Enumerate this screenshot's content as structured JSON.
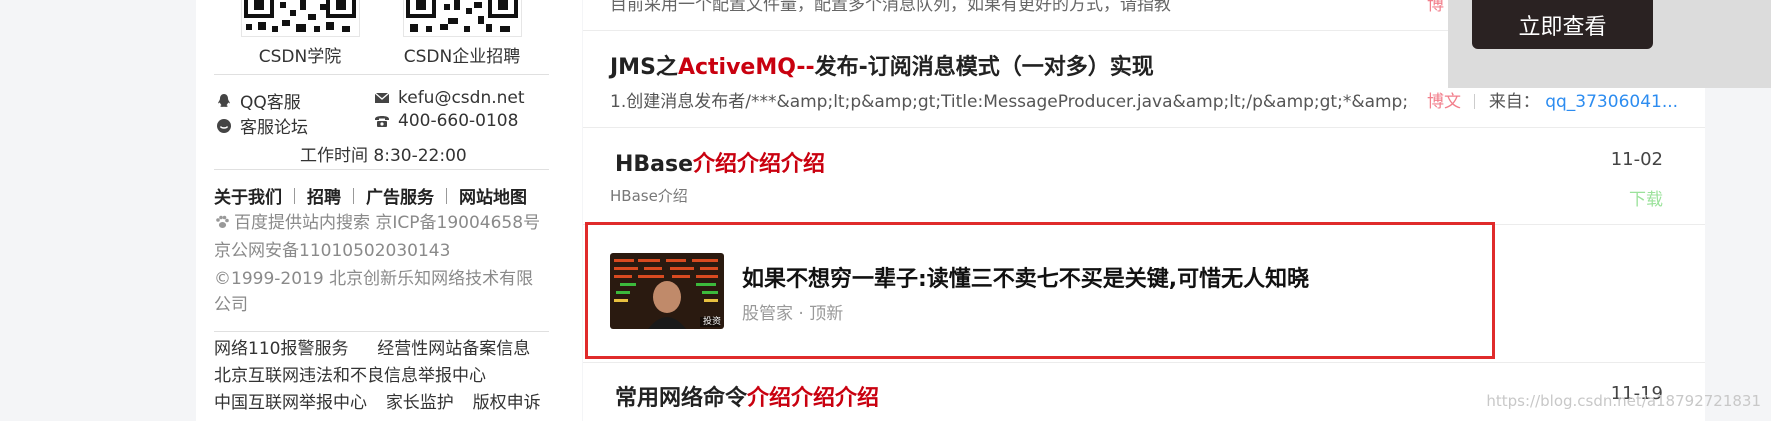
{
  "sidebar": {
    "qr_items": [
      {
        "label": "CSDN学院"
      },
      {
        "label": "CSDN企业招聘"
      }
    ],
    "contacts": {
      "qq": "QQ客服",
      "email": "kefu@csdn.net",
      "forum": "客服论坛",
      "phone": "400-660-0108"
    },
    "work_time": "工作时间 8:30-22:00",
    "footer_links": [
      "关于我们",
      "招聘",
      "广告服务",
      "网站地图"
    ],
    "gray_lines": [
      "百度提供站内搜索 京ICP备19004658号",
      "京公网安备11010502030143",
      "©1999-2019 北京创新乐知网络技术有限",
      "公司"
    ],
    "bottom_links": {
      "line1_a": "网络110报警服务",
      "line1_b": "经营性网站备案信息",
      "line2": "北京互联网违法和不良信息举报中心",
      "line3_a": "中国互联网举报中心",
      "line3_b": "家长监护",
      "line3_c": "版权申诉"
    }
  },
  "main": {
    "top_cut_text": "目前采用一个配置文件量，配置多个消息队列，如果有更好的方式，请指教",
    "top_cut_tag": "博",
    "items": [
      {
        "title_prefix": "JMS之",
        "title_red": "ActiveMQ--",
        "title_suffix": "发布-订阅消息模式（一对多）实现",
        "desc": "1.创建消息发布者/***&amp;lt;p&amp;gt;Title:MessageProducer.java&amp;lt;/p&amp;gt;*&amp;...",
        "tag": "博文",
        "from_label": "来自：",
        "from_user": "qq_37306041..."
      },
      {
        "title_prefix": "HBase",
        "title_red": "介绍介绍介绍",
        "date": "11-02",
        "sub": "HBase介绍",
        "action": "下载"
      },
      {
        "title_prefix": "常用网络命令",
        "title_red": "介绍介绍介绍",
        "date": "11-19"
      }
    ],
    "ad": {
      "title": "如果不想穷一辈子:读懂三不卖七不买是关键,可惜无人知晓",
      "source": "股管家 · 顶新",
      "thumb_caption": "投资"
    }
  },
  "overlay": {
    "button_label": "立即查看"
  },
  "watermark": "https://blog.csdn.net/a18792721831",
  "colors": {
    "accent_red": "#c9000f",
    "highlight_border": "#e02b2b",
    "link_blue": "#2c8cf0",
    "tag_pink": "#f27f8c",
    "download_green": "#9be29b"
  }
}
